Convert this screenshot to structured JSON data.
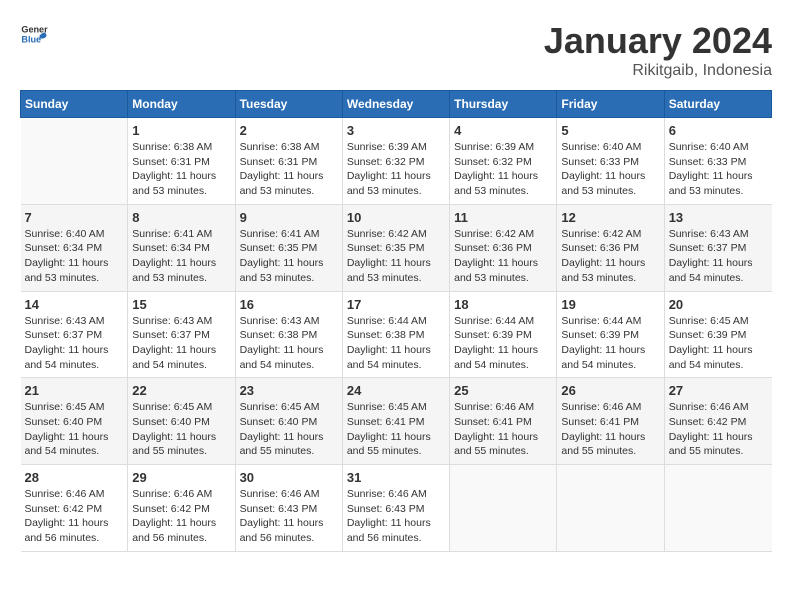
{
  "header": {
    "logo_general": "General",
    "logo_blue": "Blue",
    "title": "January 2024",
    "location": "Rikitgaib, Indonesia"
  },
  "weekdays": [
    "Sunday",
    "Monday",
    "Tuesday",
    "Wednesday",
    "Thursday",
    "Friday",
    "Saturday"
  ],
  "weeks": [
    [
      {
        "day": "",
        "sunrise": "",
        "sunset": "",
        "daylight": ""
      },
      {
        "day": "1",
        "sunrise": "Sunrise: 6:38 AM",
        "sunset": "Sunset: 6:31 PM",
        "daylight": "Daylight: 11 hours and 53 minutes."
      },
      {
        "day": "2",
        "sunrise": "Sunrise: 6:38 AM",
        "sunset": "Sunset: 6:31 PM",
        "daylight": "Daylight: 11 hours and 53 minutes."
      },
      {
        "day": "3",
        "sunrise": "Sunrise: 6:39 AM",
        "sunset": "Sunset: 6:32 PM",
        "daylight": "Daylight: 11 hours and 53 minutes."
      },
      {
        "day": "4",
        "sunrise": "Sunrise: 6:39 AM",
        "sunset": "Sunset: 6:32 PM",
        "daylight": "Daylight: 11 hours and 53 minutes."
      },
      {
        "day": "5",
        "sunrise": "Sunrise: 6:40 AM",
        "sunset": "Sunset: 6:33 PM",
        "daylight": "Daylight: 11 hours and 53 minutes."
      },
      {
        "day": "6",
        "sunrise": "Sunrise: 6:40 AM",
        "sunset": "Sunset: 6:33 PM",
        "daylight": "Daylight: 11 hours and 53 minutes."
      }
    ],
    [
      {
        "day": "7",
        "sunrise": "Sunrise: 6:40 AM",
        "sunset": "Sunset: 6:34 PM",
        "daylight": "Daylight: 11 hours and 53 minutes."
      },
      {
        "day": "8",
        "sunrise": "Sunrise: 6:41 AM",
        "sunset": "Sunset: 6:34 PM",
        "daylight": "Daylight: 11 hours and 53 minutes."
      },
      {
        "day": "9",
        "sunrise": "Sunrise: 6:41 AM",
        "sunset": "Sunset: 6:35 PM",
        "daylight": "Daylight: 11 hours and 53 minutes."
      },
      {
        "day": "10",
        "sunrise": "Sunrise: 6:42 AM",
        "sunset": "Sunset: 6:35 PM",
        "daylight": "Daylight: 11 hours and 53 minutes."
      },
      {
        "day": "11",
        "sunrise": "Sunrise: 6:42 AM",
        "sunset": "Sunset: 6:36 PM",
        "daylight": "Daylight: 11 hours and 53 minutes."
      },
      {
        "day": "12",
        "sunrise": "Sunrise: 6:42 AM",
        "sunset": "Sunset: 6:36 PM",
        "daylight": "Daylight: 11 hours and 53 minutes."
      },
      {
        "day": "13",
        "sunrise": "Sunrise: 6:43 AM",
        "sunset": "Sunset: 6:37 PM",
        "daylight": "Daylight: 11 hours and 54 minutes."
      }
    ],
    [
      {
        "day": "14",
        "sunrise": "Sunrise: 6:43 AM",
        "sunset": "Sunset: 6:37 PM",
        "daylight": "Daylight: 11 hours and 54 minutes."
      },
      {
        "day": "15",
        "sunrise": "Sunrise: 6:43 AM",
        "sunset": "Sunset: 6:37 PM",
        "daylight": "Daylight: 11 hours and 54 minutes."
      },
      {
        "day": "16",
        "sunrise": "Sunrise: 6:43 AM",
        "sunset": "Sunset: 6:38 PM",
        "daylight": "Daylight: 11 hours and 54 minutes."
      },
      {
        "day": "17",
        "sunrise": "Sunrise: 6:44 AM",
        "sunset": "Sunset: 6:38 PM",
        "daylight": "Daylight: 11 hours and 54 minutes."
      },
      {
        "day": "18",
        "sunrise": "Sunrise: 6:44 AM",
        "sunset": "Sunset: 6:39 PM",
        "daylight": "Daylight: 11 hours and 54 minutes."
      },
      {
        "day": "19",
        "sunrise": "Sunrise: 6:44 AM",
        "sunset": "Sunset: 6:39 PM",
        "daylight": "Daylight: 11 hours and 54 minutes."
      },
      {
        "day": "20",
        "sunrise": "Sunrise: 6:45 AM",
        "sunset": "Sunset: 6:39 PM",
        "daylight": "Daylight: 11 hours and 54 minutes."
      }
    ],
    [
      {
        "day": "21",
        "sunrise": "Sunrise: 6:45 AM",
        "sunset": "Sunset: 6:40 PM",
        "daylight": "Daylight: 11 hours and 54 minutes."
      },
      {
        "day": "22",
        "sunrise": "Sunrise: 6:45 AM",
        "sunset": "Sunset: 6:40 PM",
        "daylight": "Daylight: 11 hours and 55 minutes."
      },
      {
        "day": "23",
        "sunrise": "Sunrise: 6:45 AM",
        "sunset": "Sunset: 6:40 PM",
        "daylight": "Daylight: 11 hours and 55 minutes."
      },
      {
        "day": "24",
        "sunrise": "Sunrise: 6:45 AM",
        "sunset": "Sunset: 6:41 PM",
        "daylight": "Daylight: 11 hours and 55 minutes."
      },
      {
        "day": "25",
        "sunrise": "Sunrise: 6:46 AM",
        "sunset": "Sunset: 6:41 PM",
        "daylight": "Daylight: 11 hours and 55 minutes."
      },
      {
        "day": "26",
        "sunrise": "Sunrise: 6:46 AM",
        "sunset": "Sunset: 6:41 PM",
        "daylight": "Daylight: 11 hours and 55 minutes."
      },
      {
        "day": "27",
        "sunrise": "Sunrise: 6:46 AM",
        "sunset": "Sunset: 6:42 PM",
        "daylight": "Daylight: 11 hours and 55 minutes."
      }
    ],
    [
      {
        "day": "28",
        "sunrise": "Sunrise: 6:46 AM",
        "sunset": "Sunset: 6:42 PM",
        "daylight": "Daylight: 11 hours and 56 minutes."
      },
      {
        "day": "29",
        "sunrise": "Sunrise: 6:46 AM",
        "sunset": "Sunset: 6:42 PM",
        "daylight": "Daylight: 11 hours and 56 minutes."
      },
      {
        "day": "30",
        "sunrise": "Sunrise: 6:46 AM",
        "sunset": "Sunset: 6:43 PM",
        "daylight": "Daylight: 11 hours and 56 minutes."
      },
      {
        "day": "31",
        "sunrise": "Sunrise: 6:46 AM",
        "sunset": "Sunset: 6:43 PM",
        "daylight": "Daylight: 11 hours and 56 minutes."
      },
      {
        "day": "",
        "sunrise": "",
        "sunset": "",
        "daylight": ""
      },
      {
        "day": "",
        "sunrise": "",
        "sunset": "",
        "daylight": ""
      },
      {
        "day": "",
        "sunrise": "",
        "sunset": "",
        "daylight": ""
      }
    ]
  ]
}
